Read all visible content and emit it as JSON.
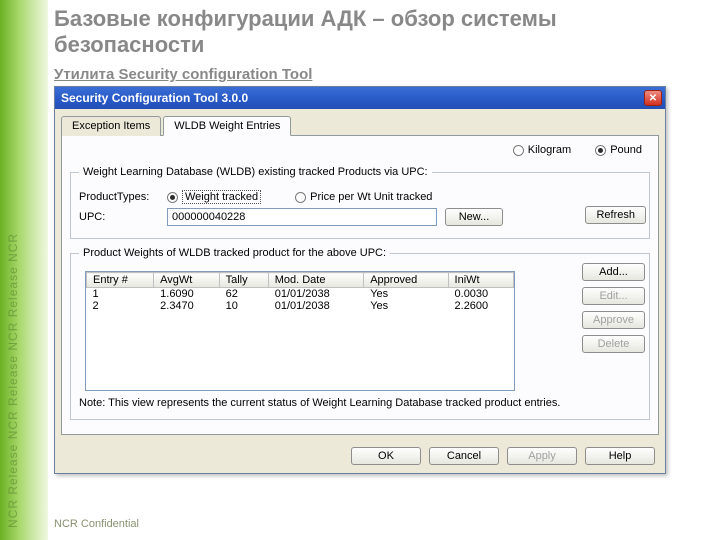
{
  "slide": {
    "title_line1": "Базовые конфигурации АДК – обзор системы",
    "title_line2": "безопасности",
    "subtitle": "Утилита Security configuration Tool",
    "footer": "NCR Confidential",
    "sidebar_text": "NCR Release NCR Release NCR Release NCR"
  },
  "window": {
    "title": "Security Configuration Tool 3.0.0",
    "tabs": {
      "t0": "Exception Items",
      "t1": "WLDB Weight Entries"
    },
    "units": {
      "kg": "Kilogram",
      "lb": "Pound",
      "selected": "lb"
    },
    "group1": {
      "legend": "Weight Learning Database (WLDB) existing tracked Products via UPC:",
      "product_types_label": "ProductTypes:",
      "opt_weight": "Weight tracked",
      "opt_price": "Price per Wt Unit tracked",
      "upc_label": "UPC:",
      "upc_value": "000000040228",
      "new_btn": "New...",
      "refresh_btn": "Refresh"
    },
    "group2": {
      "legend": "Product Weights of WLDB tracked product for the above UPC:",
      "cols": {
        "c0": "Entry #",
        "c1": "AvgWt",
        "c2": "Tally",
        "c3": "Mod. Date",
        "c4": "Approved",
        "c5": "IniWt"
      },
      "rows": [
        {
          "c0": "1",
          "c1": "1.6090",
          "c2": "62",
          "c3": "01/01/2038",
          "c4": "Yes",
          "c5": "0.0030"
        },
        {
          "c0": "2",
          "c1": "2.3470",
          "c2": "10",
          "c3": "01/01/2038",
          "c4": "Yes",
          "c5": "2.2600"
        }
      ],
      "buttons": {
        "add": "Add...",
        "edit": "Edit...",
        "approve": "Approve",
        "delete": "Delete"
      },
      "note": "Note: This view represents the current status of Weight Learning Database tracked product entries."
    },
    "footer_buttons": {
      "ok": "OK",
      "cancel": "Cancel",
      "apply": "Apply",
      "help": "Help"
    }
  }
}
